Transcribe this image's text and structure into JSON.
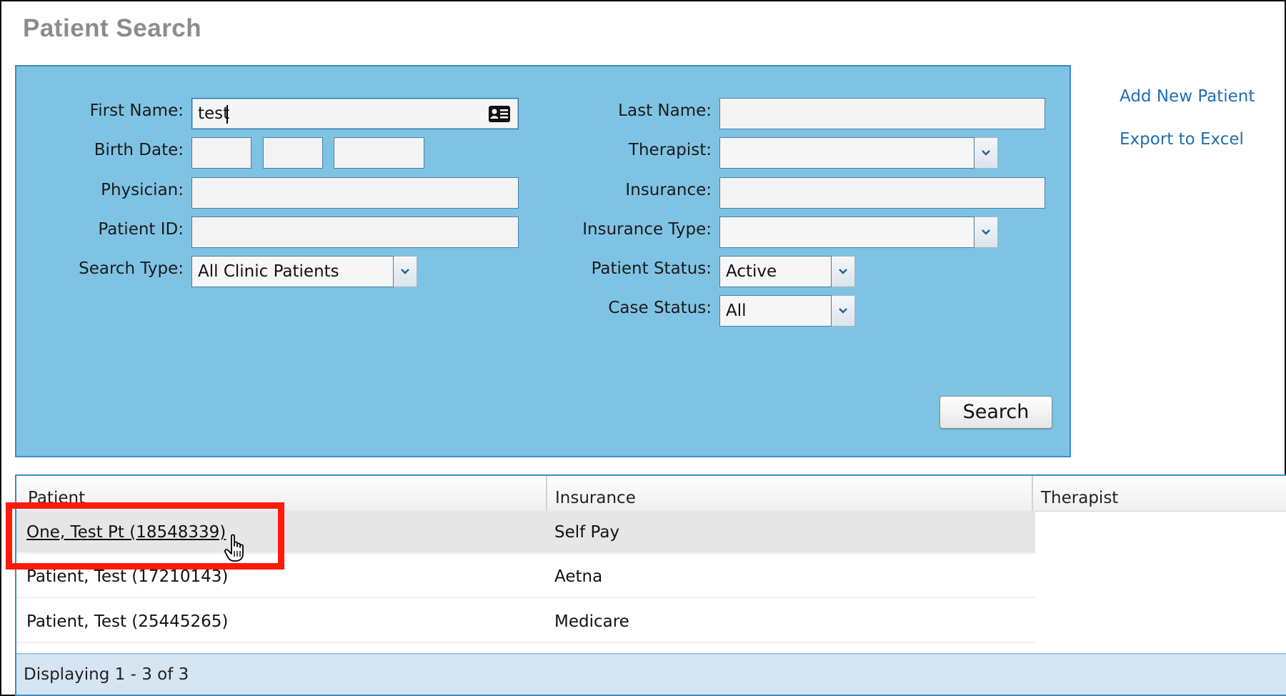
{
  "page": {
    "title": "Patient Search"
  },
  "form": {
    "first_name_label": "First Name:",
    "first_name_value": "test",
    "birth_date_label": "Birth Date:",
    "physician_label": "Physician:",
    "patient_id_label": "Patient ID:",
    "search_type_label": "Search Type:",
    "search_type_value": "All Clinic Patients",
    "last_name_label": "Last Name:",
    "therapist_label": "Therapist:",
    "insurance_label": "Insurance:",
    "insurance_type_label": "Insurance Type:",
    "patient_status_label": "Patient Status:",
    "patient_status_value": "Active",
    "case_status_label": "Case Status:",
    "case_status_value": "All",
    "search_button": "Search"
  },
  "side_links": {
    "add_new_patient": "Add New Patient",
    "export_to_excel": "Export to Excel"
  },
  "grid": {
    "columns": [
      "Patient",
      "Insurance",
      "Therapist"
    ],
    "rows": [
      {
        "patient": "One, Test Pt (18548339)",
        "insurance": "Self Pay",
        "therapist": ""
      },
      {
        "patient": "Patient, Test (17210143)",
        "insurance": "Aetna",
        "therapist": ""
      },
      {
        "patient": "Patient, Test (25445265)",
        "insurance": "Medicare",
        "therapist": ""
      }
    ],
    "footer": "Displaying 1 - 3 of 3"
  },
  "colors": {
    "panel_bg": "#7fc3e4",
    "link": "#1f6fb0",
    "highlight": "#ff1a0a"
  },
  "icons": [
    "contact-card-icon",
    "chevron-down-icon",
    "hand-pointer-cursor-icon"
  ]
}
